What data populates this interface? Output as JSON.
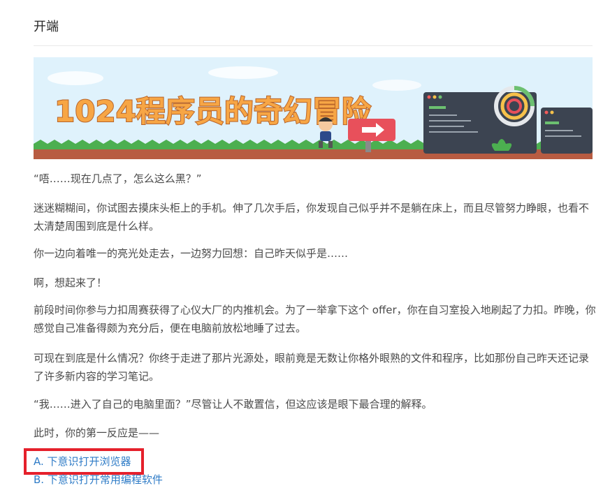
{
  "section": {
    "title": "开端"
  },
  "banner": {
    "title": "1024程序员的奇幻冒险",
    "colors": {
      "sky": "#dff2fc",
      "title_fill": "#f7a645",
      "ground": "#b85c42",
      "grass": "#4caf50",
      "sign": "#e8505b"
    }
  },
  "story": {
    "paragraphs": [
      "“唔……现在几点了，怎么这么黑？”",
      "迷迷糊糊间，你试图去摸床头柜上的手机。伸了几次手后，你发现自己似乎并不是躺在床上，而且尽管努力睁眼，也看不太清楚周围到底是什么样。",
      "你一边向着唯一的亮光处走去，一边努力回想：自己昨天似乎是……",
      "啊，想起来了！",
      "前段时间你参与力扣周赛获得了心仪大厂的内推机会。为了一举拿下这个 offer，你在自习室投入地刷起了力扣。昨晚，你感觉自己准备得颇为充分后，便在电脑前放松地睡了过去。",
      "可现在到底是什么情况？你终于走进了那片光源处，眼前竟是无数让你格外眼熟的文件和程序，比如那份自己昨天还记录了许多新内容的学习笔记。",
      "“我……进入了自己的电脑里面？”尽管让人不敢置信，但这应该是眼下最合理的解释。",
      "此时，你的第一反应是——"
    ],
    "options": [
      "A. 下意识打开浏览器",
      "B. 下意识打开常用编程软件"
    ]
  }
}
